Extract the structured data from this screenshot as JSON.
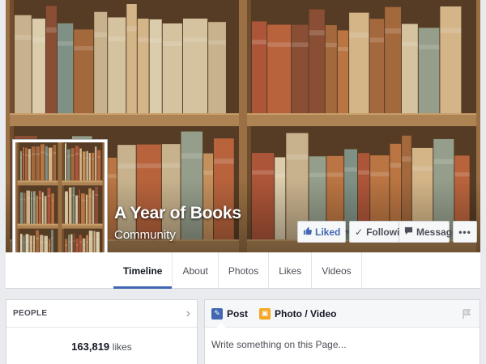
{
  "page": {
    "title": "A Year of Books",
    "category": "Community"
  },
  "actions": {
    "liked_label": "Liked",
    "following_label": "Following",
    "message_label": "Message",
    "more_label": "•••"
  },
  "nav": {
    "tabs": [
      {
        "label": "Timeline",
        "active": true
      },
      {
        "label": "About"
      },
      {
        "label": "Photos"
      },
      {
        "label": "Likes"
      },
      {
        "label": "Videos"
      }
    ]
  },
  "people": {
    "title": "PEOPLE",
    "likes_count": "163,819",
    "likes_unit": "likes"
  },
  "composer": {
    "tabs": [
      {
        "label": "Post",
        "icon": "pencil-icon"
      },
      {
        "label": "Photo / Video",
        "icon": "photo-icon"
      }
    ],
    "placeholder": "Write something on this Page..."
  },
  "colors": {
    "accent": "#4267b2",
    "background": "#e9ebee",
    "wood": "#7a4a22"
  }
}
